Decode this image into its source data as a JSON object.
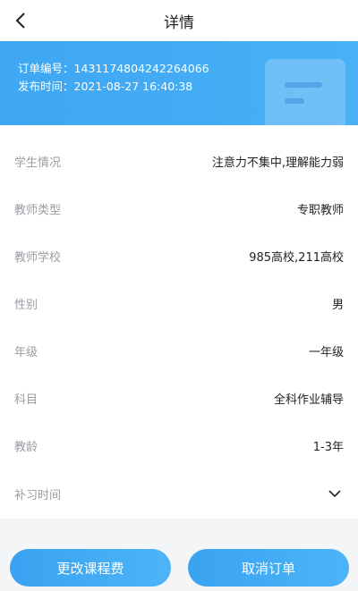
{
  "header": {
    "title": "详情"
  },
  "order": {
    "number_line": "订单编号：1431174804242264066",
    "time_line": "发布时间：2021-08-27 16:40:38"
  },
  "details": [
    {
      "label": "学生情况",
      "value": "注意力不集中,理解能力弱"
    },
    {
      "label": "教师类型",
      "value": "专职教师"
    },
    {
      "label": "教师学校",
      "value": "985高校,211高校"
    },
    {
      "label": "性别",
      "value": "男"
    },
    {
      "label": "年级",
      "value": "一年级"
    },
    {
      "label": "科目",
      "value": "全科作业辅导"
    },
    {
      "label": "教龄",
      "value": "1-3年"
    },
    {
      "label": "补习时间",
      "value": ""
    }
  ],
  "actions": {
    "change_fee": "更改课程费",
    "cancel_order": "取消订单"
  },
  "colors": {
    "accent": "#3fa7f3",
    "label": "#9a9da3",
    "text": "#222222"
  }
}
